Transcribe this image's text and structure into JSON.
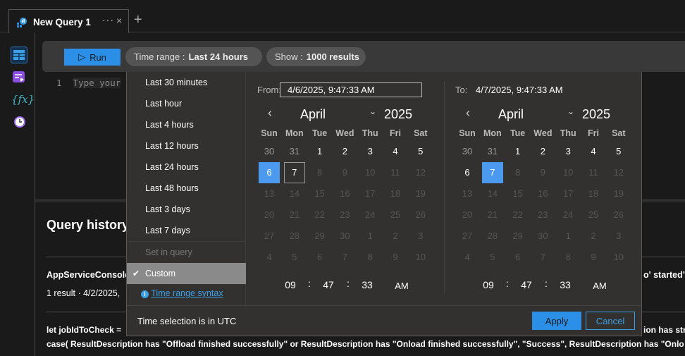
{
  "tab": {
    "title": "New Query 1",
    "more": "···",
    "close": "×",
    "add": "+"
  },
  "toolbar": {
    "run": "Run",
    "time_range_label": "Time range :",
    "time_range_value": "Last 24 hours",
    "show_label": "Show :",
    "show_value": "1000 results"
  },
  "editor": {
    "line_number": "1",
    "placeholder": "Type your"
  },
  "history": {
    "title": "Query history",
    "item1_query": "AppServiceConsole",
    "item1_tail": "o' started\"",
    "item1_meta": "1 result · 4/2/2025,",
    "item2_line1": "let jobIdToCheck =",
    "item2_line1_tail": "ion has stre",
    "item2_line2": "case( ResultDescription has \"Offload finished successfully\" or ResultDescription has \"Onload finished successfully\", \"Success\", ResultDescription has \"Onlo"
  },
  "time_options": [
    "Last 30 minutes",
    "Last hour",
    "Last 4 hours",
    "Last 12 hours",
    "Last 24 hours",
    "Last 48 hours",
    "Last 3 days",
    "Last 7 days"
  ],
  "set_in_query": "Set in query",
  "custom": "Custom",
  "syntax_link": "Time range syntax",
  "utc_note": "Time selection is in UTC",
  "apply": "Apply",
  "cancel": "Cancel",
  "weekdays": [
    "Sun",
    "Mon",
    "Tue",
    "Wed",
    "Thu",
    "Fri",
    "Sat"
  ],
  "days": [
    [
      30,
      31,
      1,
      2,
      3,
      4,
      5
    ],
    [
      6,
      7,
      8,
      9,
      10,
      11,
      12
    ],
    [
      13,
      14,
      15,
      16,
      17,
      18,
      19
    ],
    [
      20,
      21,
      22,
      23,
      24,
      25,
      26
    ],
    [
      27,
      28,
      29,
      30,
      1,
      2,
      3
    ],
    [
      4,
      5,
      6,
      7,
      8,
      9,
      10
    ]
  ],
  "from": {
    "label": "From:",
    "value": "4/6/2025, 9:47:33 AM",
    "month": "April",
    "year": "2025",
    "selected_day": 6,
    "outlined_day": 7,
    "hour": "09",
    "minute": "47",
    "second": "33",
    "ampm": "AM"
  },
  "to": {
    "label": "To:",
    "value": "4/7/2025, 9:47:33 AM",
    "month": "April",
    "year": "2025",
    "selected_day": 7,
    "hour": "09",
    "minute": "47",
    "second": "33",
    "ampm": "AM"
  },
  "colors": {
    "accent": "#2b8fe8",
    "selected_day": "#4c9aef"
  }
}
